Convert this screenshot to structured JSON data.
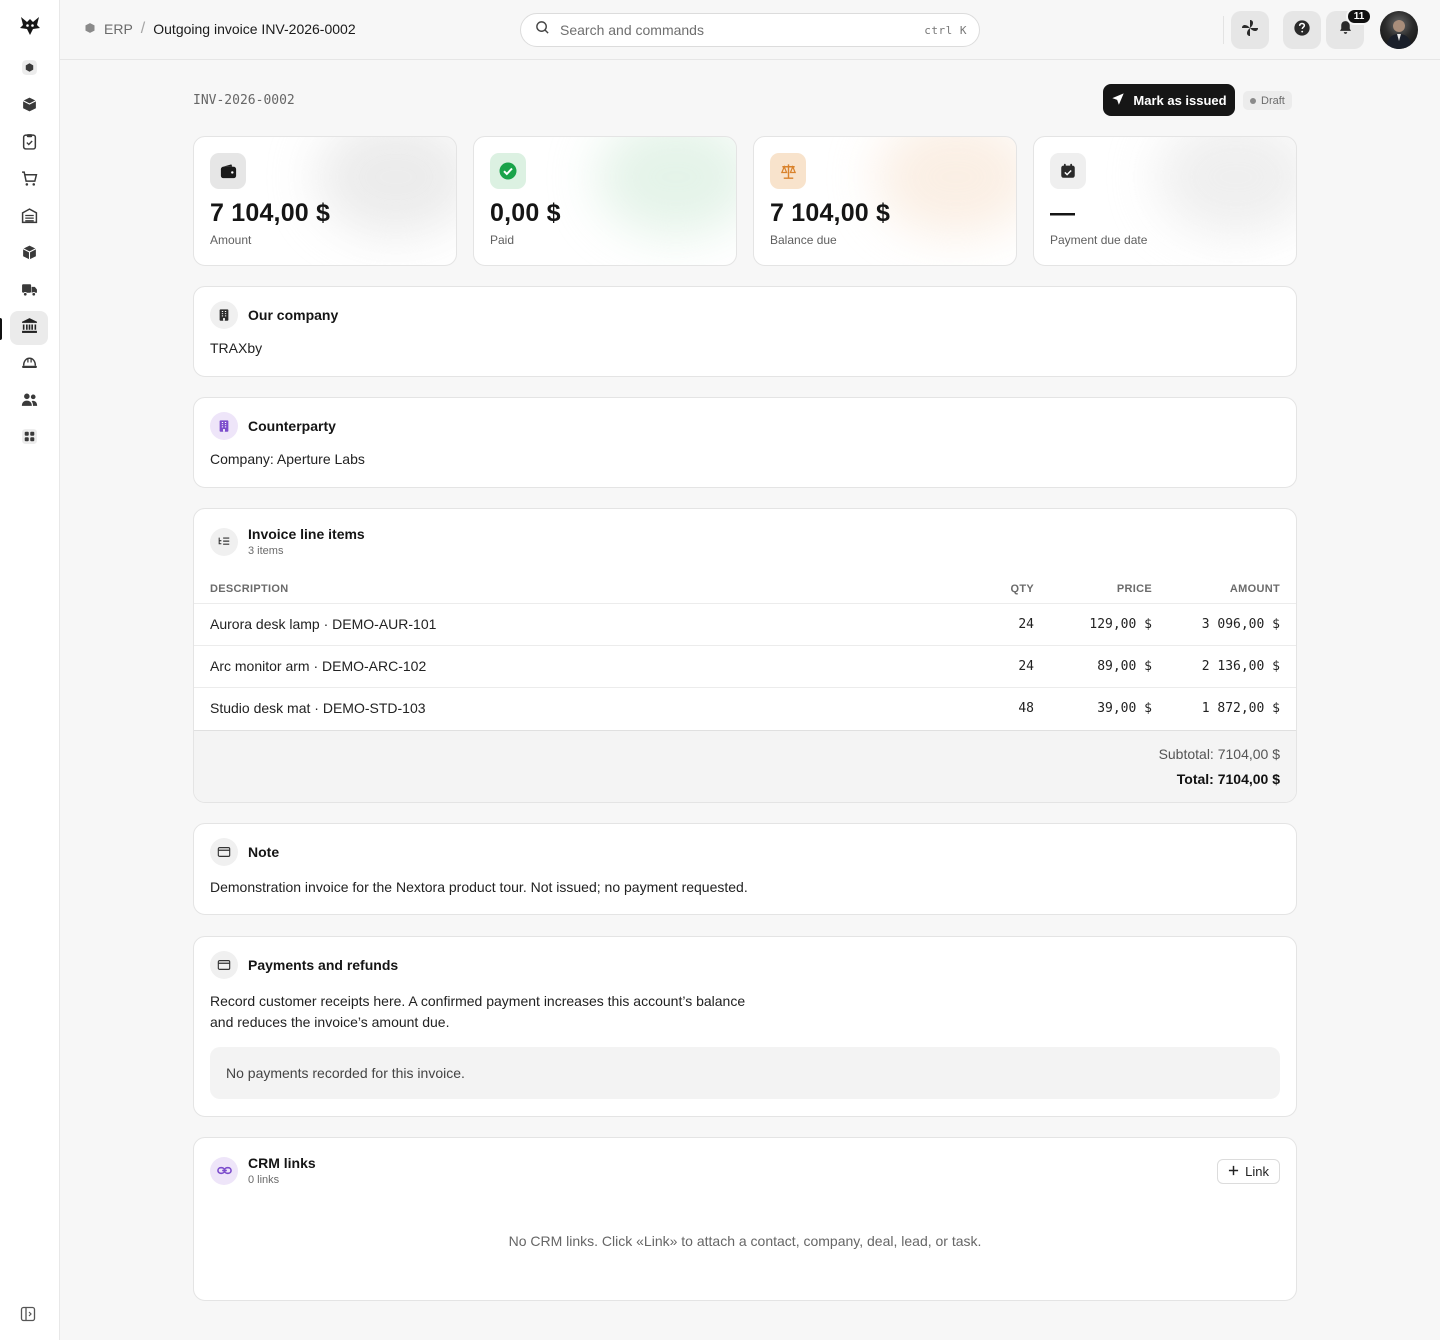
{
  "header": {
    "breadcrumb_root": "ERP",
    "breadcrumb_separator": "/",
    "page_title": "Outgoing invoice INV-2026-0002",
    "search_placeholder": "Search and commands",
    "search_shortcut": "ctrl K",
    "notification_count": "11"
  },
  "sidebar": {
    "items": [
      {
        "icon": "cube-icon"
      },
      {
        "icon": "box-icon"
      },
      {
        "icon": "clipboard-icon"
      },
      {
        "icon": "cart-icon"
      },
      {
        "icon": "warehouse-icon"
      },
      {
        "icon": "package-icon"
      },
      {
        "icon": "truck-icon"
      },
      {
        "icon": "bank-icon",
        "active": true
      },
      {
        "icon": "hard-hat-icon"
      },
      {
        "icon": "users-icon"
      },
      {
        "icon": "apps-grid-icon"
      }
    ]
  },
  "document": {
    "number": "INV-2026-0002",
    "action_label": "Mark as issued",
    "status": "Draft"
  },
  "stats": [
    {
      "value": "7 104,00 $",
      "label": "Amount",
      "icon": "wallet-icon"
    },
    {
      "value": "0,00 $",
      "label": "Paid",
      "icon": "check-circle-icon"
    },
    {
      "value": "7 104,00 $",
      "label": "Balance due",
      "icon": "scales-icon"
    },
    {
      "value": "—",
      "label": "Payment due date",
      "icon": "calendar-icon"
    }
  ],
  "our_company": {
    "title": "Our company",
    "value": "TRAXby"
  },
  "counterparty": {
    "title": "Counterparty",
    "value": "Company: Aperture Labs"
  },
  "line_items": {
    "title": "Invoice line items",
    "subtitle": "3 items",
    "columns": {
      "description": "DESCRIPTION",
      "qty": "QTY",
      "price": "PRICE",
      "amount": "AMOUNT"
    },
    "rows": [
      {
        "description": "Aurora desk lamp · DEMO-AUR-101",
        "qty": "24",
        "price": "129,00 $",
        "amount": "3 096,00 $"
      },
      {
        "description": "Arc monitor arm · DEMO-ARC-102",
        "qty": "24",
        "price": "89,00 $",
        "amount": "2 136,00 $"
      },
      {
        "description": "Studio desk mat · DEMO-STD-103",
        "qty": "48",
        "price": "39,00 $",
        "amount": "1 872,00 $"
      }
    ],
    "subtotal": "Subtotal: 7104,00 $",
    "total": "Total: 7104,00 $"
  },
  "note": {
    "title": "Note",
    "text": "Demonstration invoice for the Nextora product tour. Not issued; no payment requested."
  },
  "payments": {
    "title": "Payments and refunds",
    "description_line1": "Record customer receipts here. A confirmed payment increases this account’s balance",
    "description_line2": "and reduces the invoice’s amount due.",
    "empty": "No payments recorded for this invoice."
  },
  "crm": {
    "title": "CRM links",
    "subtitle": "0 links",
    "link_button": "Link",
    "empty": "No CRM links. Click «Link» to attach a contact, company, deal, lead, or task."
  },
  "colors": {
    "accent_dark": "#161616",
    "success": "#1aa34a",
    "warning": "#d9822b",
    "purple": "#7c4dcc"
  }
}
